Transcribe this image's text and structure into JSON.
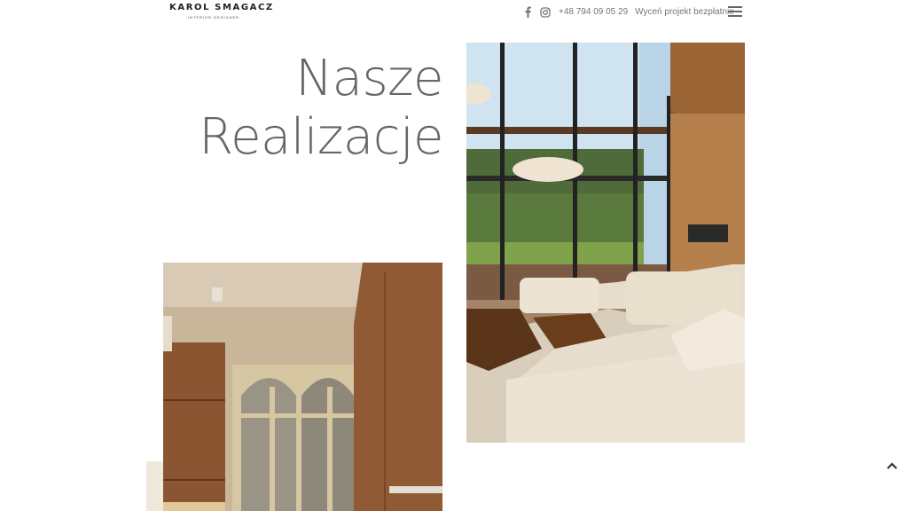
{
  "header": {
    "logo_name": "KAROL SMAGACZ",
    "logo_sub": "INTERIOR DESIGNER",
    "phone": "+48 794 09 05 29",
    "cta": "Wyceń projekt bezpłatnie",
    "icons": {
      "facebook": "facebook-icon",
      "instagram": "instagram-icon",
      "menu": "hamburger-menu-icon"
    }
  },
  "hero": {
    "title_line1": "Nasze",
    "title_line2": "Realizacje"
  },
  "gallery": {
    "items": [
      {
        "name": "living-room-photo",
        "description": ""
      },
      {
        "name": "hallway-photo",
        "description": ""
      }
    ]
  },
  "ui": {
    "scroll_top_icon": "chevron-up-icon"
  },
  "colors": {
    "background": "#ffffff",
    "heading": "#666666",
    "text": "#777777",
    "wood": "#8a5a32"
  }
}
